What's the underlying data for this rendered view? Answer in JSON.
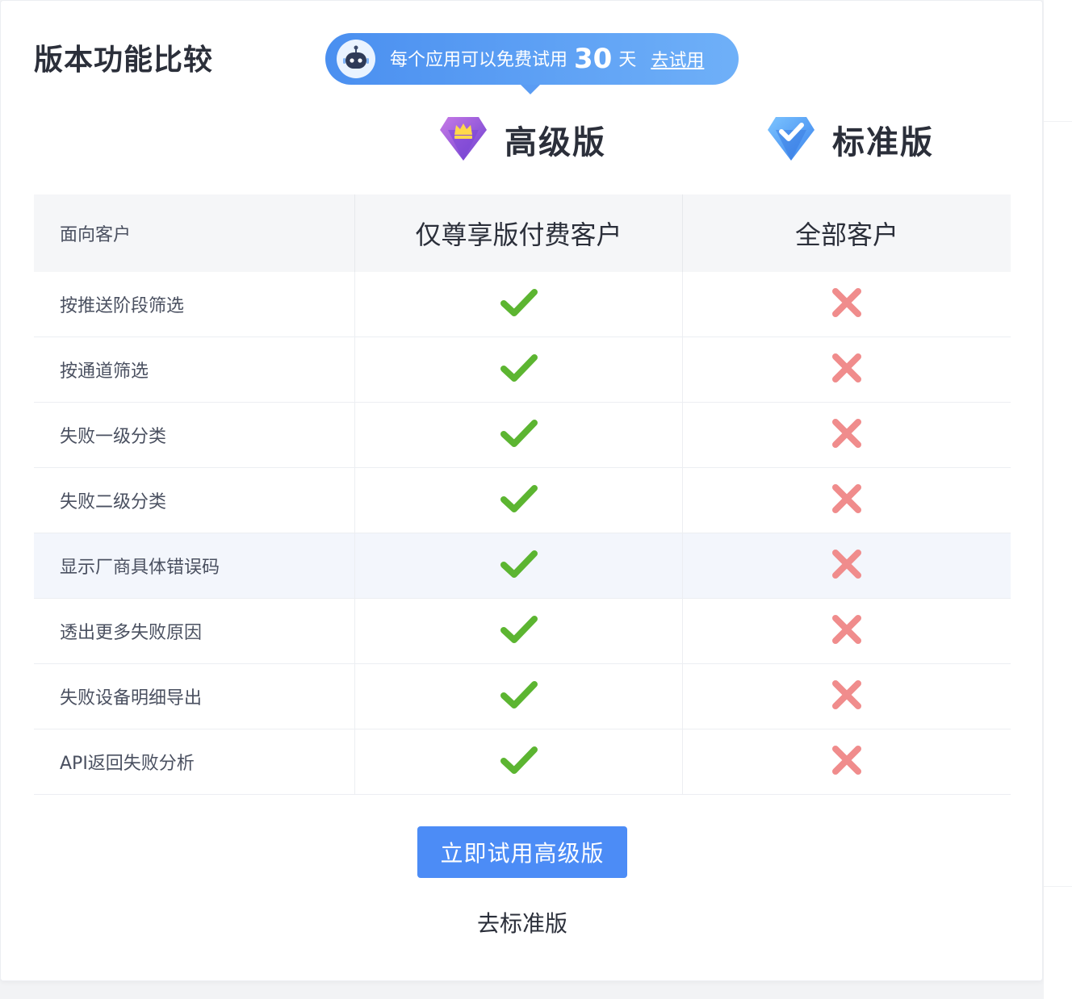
{
  "page": {
    "title": "版本功能比较"
  },
  "trial_banner": {
    "text_prefix": "每个应用可以免费试用",
    "days": "30",
    "text_suffix": "天",
    "link_label": "去试用",
    "icon": "robot-icon"
  },
  "plans": {
    "premium": {
      "name": "高级版",
      "icon": "crown-gem-icon"
    },
    "standard": {
      "name": "标准版",
      "icon": "check-gem-icon"
    }
  },
  "table": {
    "header": {
      "label": "面向客户",
      "premium": "仅尊享版付费客户",
      "standard": "全部客户"
    },
    "rows": [
      {
        "feature": "按推送阶段筛选",
        "premium": true,
        "standard": false
      },
      {
        "feature": "按通道筛选",
        "premium": true,
        "standard": false
      },
      {
        "feature": "失败一级分类",
        "premium": true,
        "standard": false
      },
      {
        "feature": "失败二级分类",
        "premium": true,
        "standard": false
      },
      {
        "feature": "显示厂商具体错误码",
        "premium": true,
        "standard": false
      },
      {
        "feature": "透出更多失败原因",
        "premium": true,
        "standard": false
      },
      {
        "feature": "失败设备明细导出",
        "premium": true,
        "standard": false
      },
      {
        "feature": "API返回失败分析",
        "premium": true,
        "standard": false
      }
    ],
    "highlighted_row": 4
  },
  "actions": {
    "primary_label": "立即试用高级版",
    "secondary_label": "去标准版"
  },
  "colors": {
    "accent": "#4c8cf6",
    "check": "#5cb531",
    "cross": "#f08c8c",
    "title": "#2b2f3a"
  }
}
